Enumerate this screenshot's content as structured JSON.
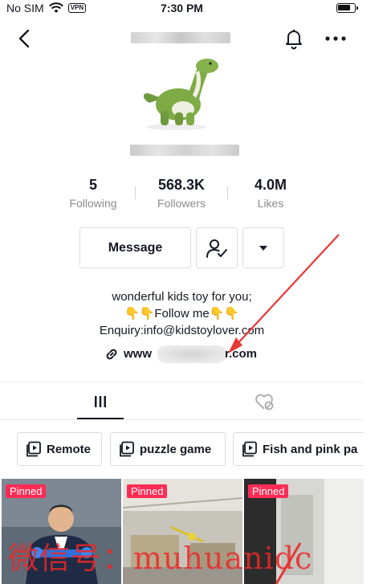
{
  "status_bar": {
    "carrier": "No SIM",
    "vpn": "VPN",
    "time": "7:30 PM"
  },
  "header": {
    "back_icon": "chevron-left-icon",
    "bell_icon": "bell-icon",
    "more_icon": "more-horizontal-icon"
  },
  "stats": [
    {
      "value": "5",
      "label": "Following"
    },
    {
      "value": "568.3K",
      "label": "Followers"
    },
    {
      "value": "4.0M",
      "label": "Likes"
    }
  ],
  "actions": {
    "message_label": "Message",
    "follow_icon": "user-check-icon",
    "dropdown_icon": "caret-down-icon"
  },
  "bio": {
    "line1": "wonderful kids toy for you;",
    "line2": "👇👇Follow me👇👇",
    "line3": "Enquiry:info@kidstoylover.com",
    "link_prefix": "www",
    "link_suffix": "r.com"
  },
  "tabs": [
    {
      "icon": "grid-icon",
      "active": true
    },
    {
      "icon": "liked-hidden-icon",
      "active": false
    }
  ],
  "playlists": [
    {
      "label": "Remote"
    },
    {
      "label": "puzzle game"
    },
    {
      "label": "Fish and pink pa"
    }
  ],
  "videos": [
    {
      "badge": "Pinned"
    },
    {
      "badge": "Pinned"
    },
    {
      "badge": "Pinned"
    }
  ],
  "watermark": "微信号：muhuanidc",
  "colors": {
    "accent": "#fe2c55",
    "annotation": "#e53935",
    "muted_text": "#8a8b91"
  }
}
